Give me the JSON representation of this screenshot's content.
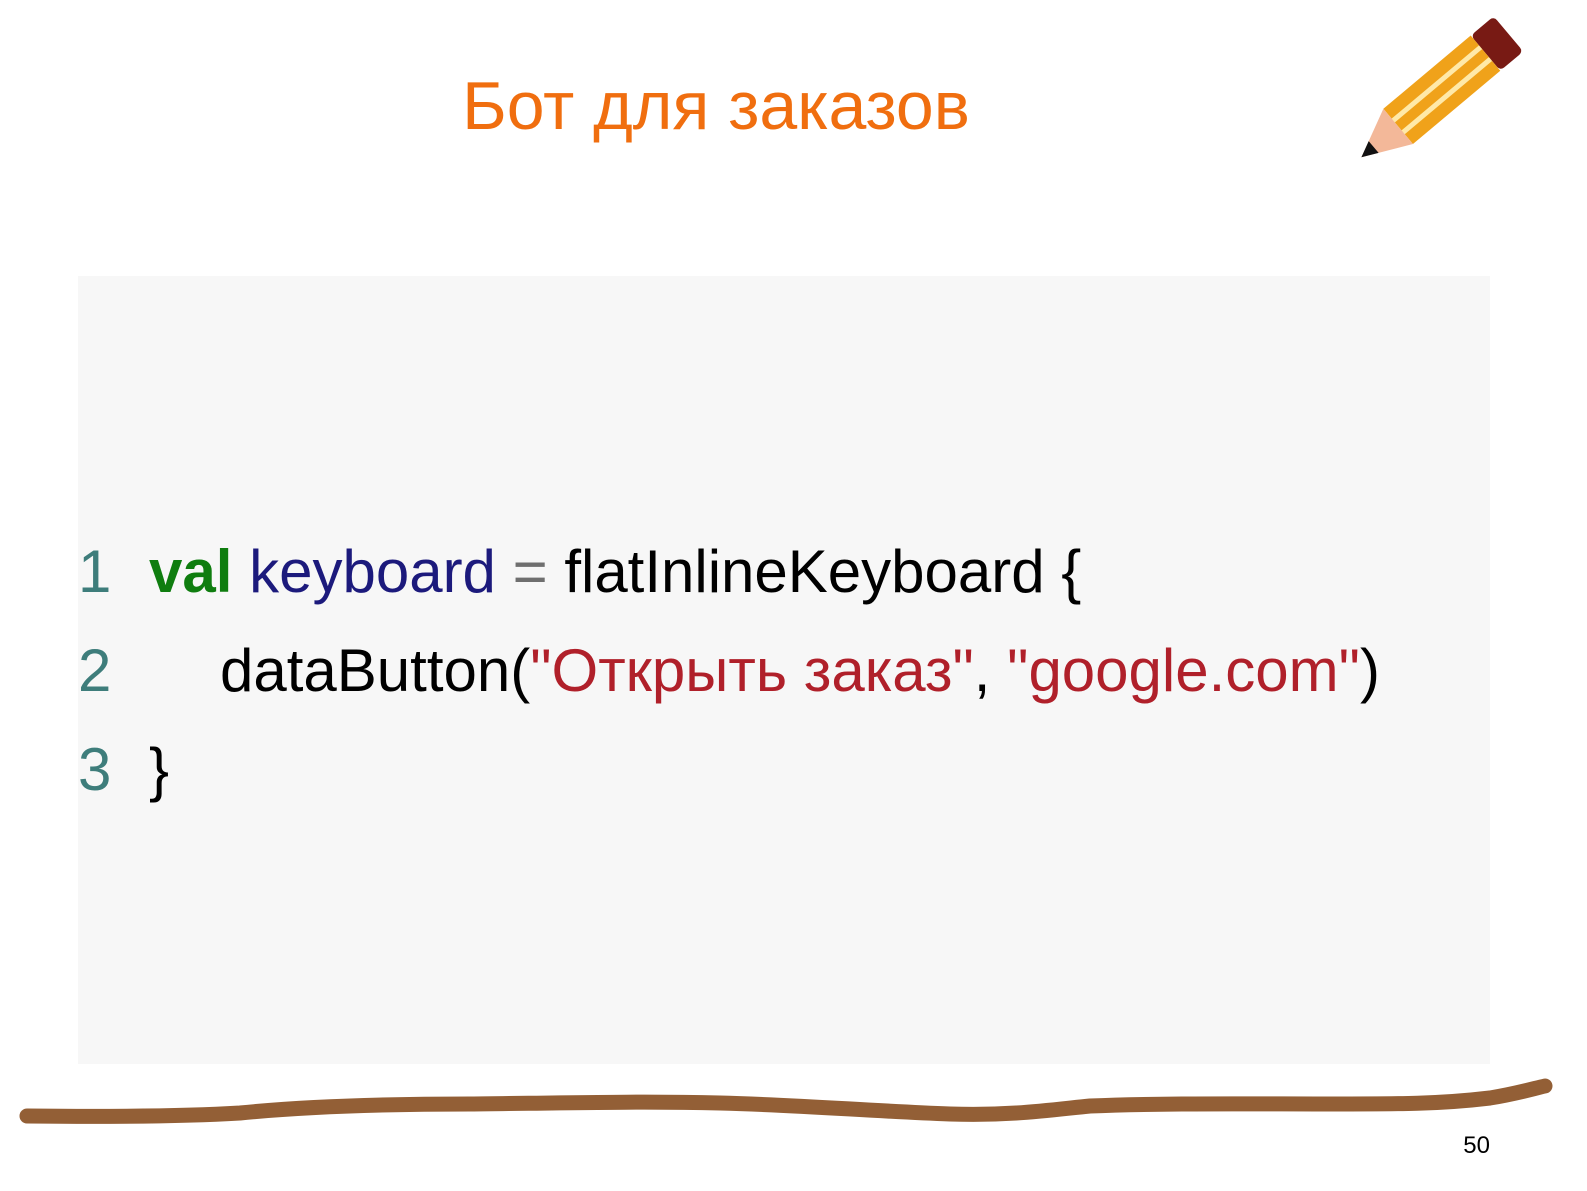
{
  "slide": {
    "title": "Бот для заказов",
    "page_number": "50",
    "icons": {
      "decoration": "pencil-icon"
    },
    "colors": {
      "title": "#f06e0f",
      "code_background": "#f7f7f7",
      "keyword": "#0f7d0f",
      "identifier": "#1c1a7c",
      "string": "#b0202a",
      "line_number": "#3e7d7b",
      "rule": "#935f36"
    }
  },
  "code": {
    "lines": [
      {
        "number": "1",
        "keyword": "val",
        "identifier": "keyboard",
        "operator": "=",
        "call": "flatInlineKeyboard {"
      },
      {
        "number": "2",
        "call": "dataButton(",
        "arg1": "\"Открыть заказ\"",
        "separator": ", ",
        "arg2": "\"google.com\"",
        "close": ")"
      },
      {
        "number": "3",
        "text": "}"
      }
    ]
  }
}
